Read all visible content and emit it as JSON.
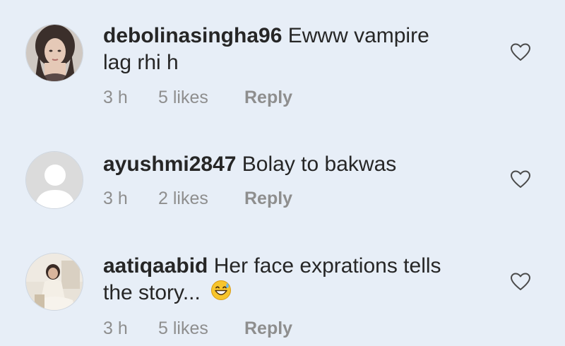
{
  "comments": [
    {
      "username": "debolinasingha96",
      "text_line1": "Ewww vampire",
      "text_line2": "lag rhi h",
      "time": "3 h",
      "likes": "5 likes",
      "reply": "Reply"
    },
    {
      "username": "ayushmi2847",
      "text_line1": "Bolay to bakwas",
      "time": "3 h",
      "likes": "2 likes",
      "reply": "Reply"
    },
    {
      "username": "aatiqaabid",
      "text_line1": "Her face exprations tells",
      "text_line2": "the story...",
      "emoji": "grinning-sweat-emoji",
      "time": "3 h",
      "likes": "5 likes",
      "reply": "Reply"
    }
  ],
  "colors": {
    "background": "#e7eef7",
    "text": "#262626",
    "meta": "#8e8e8e"
  }
}
